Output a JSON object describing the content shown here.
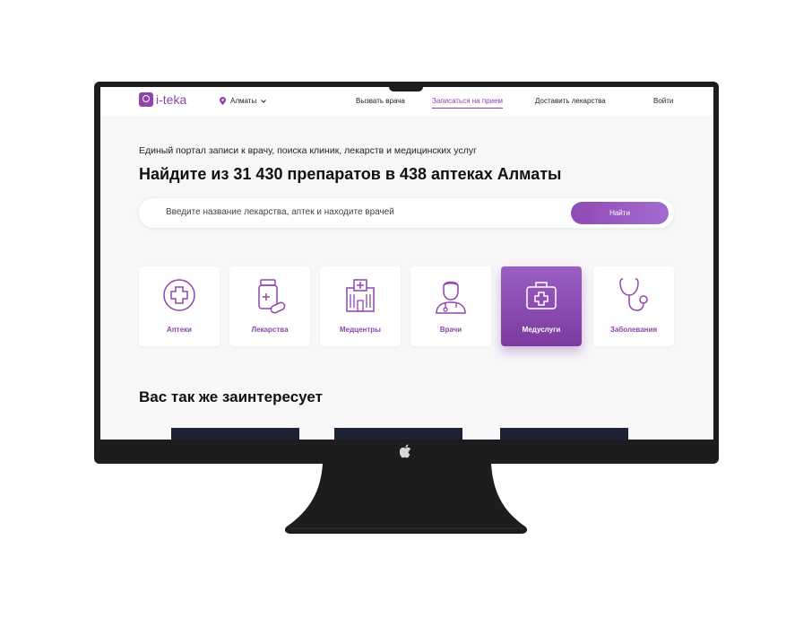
{
  "header": {
    "logo_text": "i-teka",
    "city": "Алматы",
    "nav": [
      "Вызвать врача",
      "Записаться на прием",
      "Доставить лекарства"
    ],
    "login": "Войти"
  },
  "hero": {
    "subtitle": "Единый портал записи к врачу, поиска клиник, лекарств и медицинских услуг",
    "title": "Найдите из 31 430 препаратов в 438 аптеках Алматы",
    "search_placeholder": "Введите название лекарства, аптек и находите врачей",
    "search_button": "Найти"
  },
  "categories": [
    {
      "label": "Аптеки",
      "icon": "pharmacy-cross-icon"
    },
    {
      "label": "Лекарства",
      "icon": "medicine-bottle-icon"
    },
    {
      "label": "Медцентры",
      "icon": "hospital-building-icon"
    },
    {
      "label": "Врачи",
      "icon": "doctor-icon"
    },
    {
      "label": "Медуслуги",
      "icon": "medical-kit-icon"
    },
    {
      "label": "Заболевания",
      "icon": "stethoscope-icon"
    }
  ],
  "active_category": "Медуслуги",
  "section_title": "Вас так же заинтересует",
  "colors": {
    "accent": "#8e44ad",
    "background": "#f7f7f8",
    "monitor": "#1d1d1f"
  }
}
